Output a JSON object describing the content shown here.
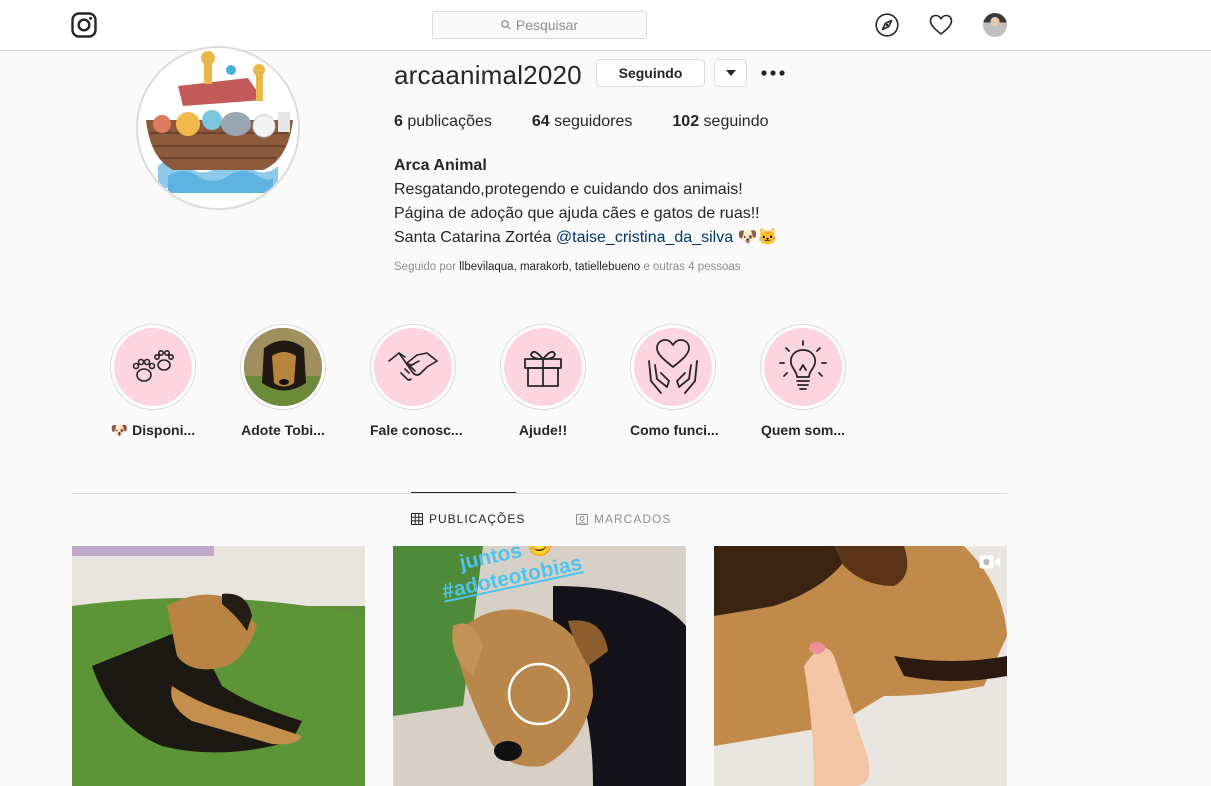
{
  "topbar": {
    "logo_icon": "instagram-icon",
    "search_placeholder": "Pesquisar"
  },
  "profile": {
    "username": "arcaanimal2020",
    "following_button": "Seguindo",
    "stats": [
      {
        "count": "6",
        "label": "publicações"
      },
      {
        "count": "64",
        "label": "seguidores"
      },
      {
        "count": "102",
        "label": "seguindo"
      }
    ],
    "bio": {
      "name": "Arca Animal",
      "line1": "Resgatando,protegendo e cuidando dos animais!",
      "line2": "Página de adoção que ajuda cães e gatos de ruas!!",
      "line3_text": "Santa Catarina Zortéa",
      "line3_mention": "@taise_cristina_da_silva",
      "line3_emoji": "🐶🐱"
    },
    "followed_by": {
      "prefix": "Seguido por",
      "names": "llbevilaqua, marakorb, tatiellebueno",
      "suffix": "e outras 4 pessoas"
    }
  },
  "highlights": [
    {
      "label": "🐶 Disponi...",
      "icon": "paws-icon"
    },
    {
      "label": "Adote Tobi...",
      "icon": "dog-photo"
    },
    {
      "label": "Fale conosc...",
      "icon": "handshake-icon"
    },
    {
      "label": "Ajude!!",
      "icon": "gift-icon"
    },
    {
      "label": "Como funci...",
      "icon": "heart-hands-icon"
    },
    {
      "label": "Quem som...",
      "icon": "lightbulb-icon"
    }
  ],
  "tabs": [
    {
      "label": "PUBLICAÇÕES",
      "active": true
    },
    {
      "label": "MARCADOS",
      "active": false
    }
  ],
  "posts": [
    {
      "overlay_text": ""
    },
    {
      "overlay_text_1": "juntos 😊",
      "overlay_text_2": "#adoteotobias"
    },
    {
      "overlay_text": ""
    }
  ],
  "colors": {
    "highlight_bg": "#fdd5e1",
    "border": "#dbdbdb",
    "text": "#262626",
    "muted": "#8e8e8e",
    "link": "#00376b"
  }
}
